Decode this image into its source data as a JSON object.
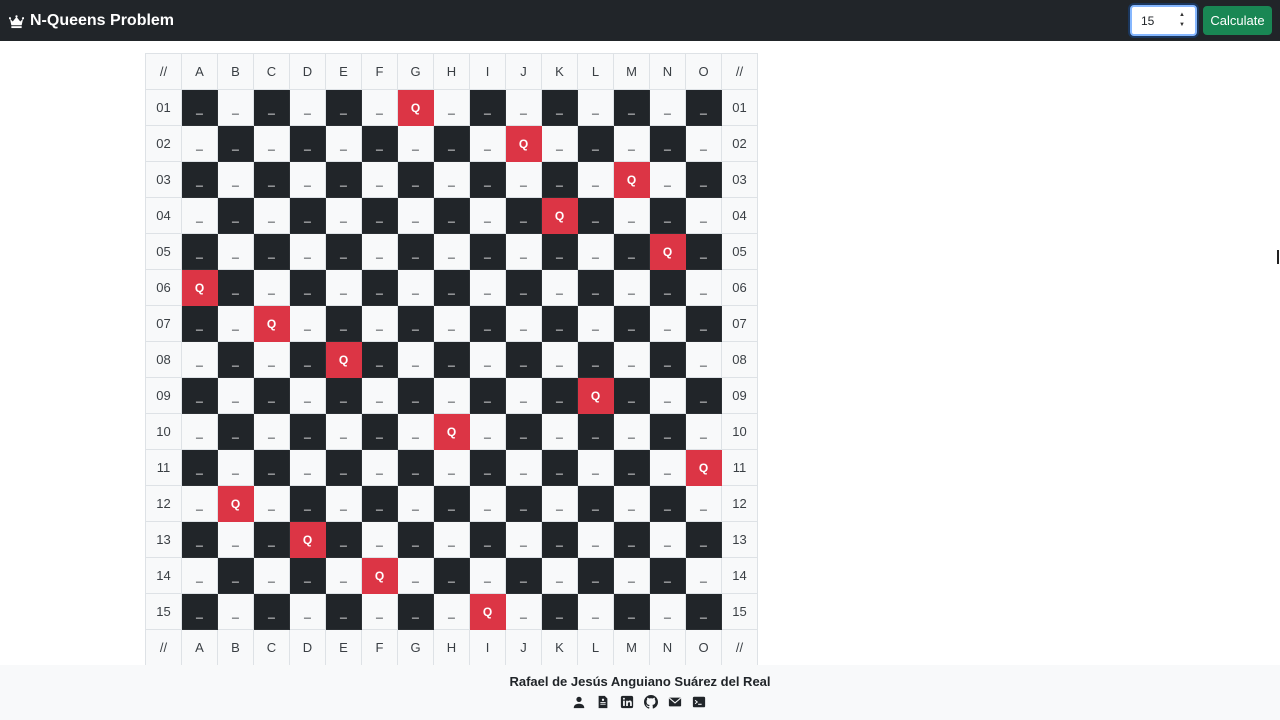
{
  "header": {
    "brand_icon": "crown-icon",
    "title": "N-Queens Problem",
    "n_value": "15",
    "calculate_label": "Calculate"
  },
  "board": {
    "size": 15,
    "corner_label": "//",
    "columns": [
      "A",
      "B",
      "C",
      "D",
      "E",
      "F",
      "G",
      "H",
      "I",
      "J",
      "K",
      "L",
      "M",
      "N",
      "O"
    ],
    "rows": [
      "01",
      "02",
      "03",
      "04",
      "05",
      "06",
      "07",
      "08",
      "09",
      "10",
      "11",
      "12",
      "13",
      "14",
      "15"
    ],
    "empty_mark": "_",
    "queen_mark": "Q",
    "queen_columns": [
      "G",
      "J",
      "M",
      "K",
      "N",
      "A",
      "C",
      "E",
      "L",
      "H",
      "O",
      "B",
      "D",
      "F",
      "I"
    ],
    "colors": {
      "dark": "#212529",
      "light": "#f8f9fa",
      "queen": "#dc3545"
    }
  },
  "footer": {
    "author": "Rafael de Jesús Anguiano Suárez del Real",
    "icons": [
      "person-icon",
      "resume-icon",
      "linkedin-icon",
      "github-icon",
      "email-icon",
      "terminal-icon"
    ]
  },
  "colors": {
    "navbar": "#212529",
    "accent": "#198754",
    "footer_bg": "#f8f9fa"
  }
}
